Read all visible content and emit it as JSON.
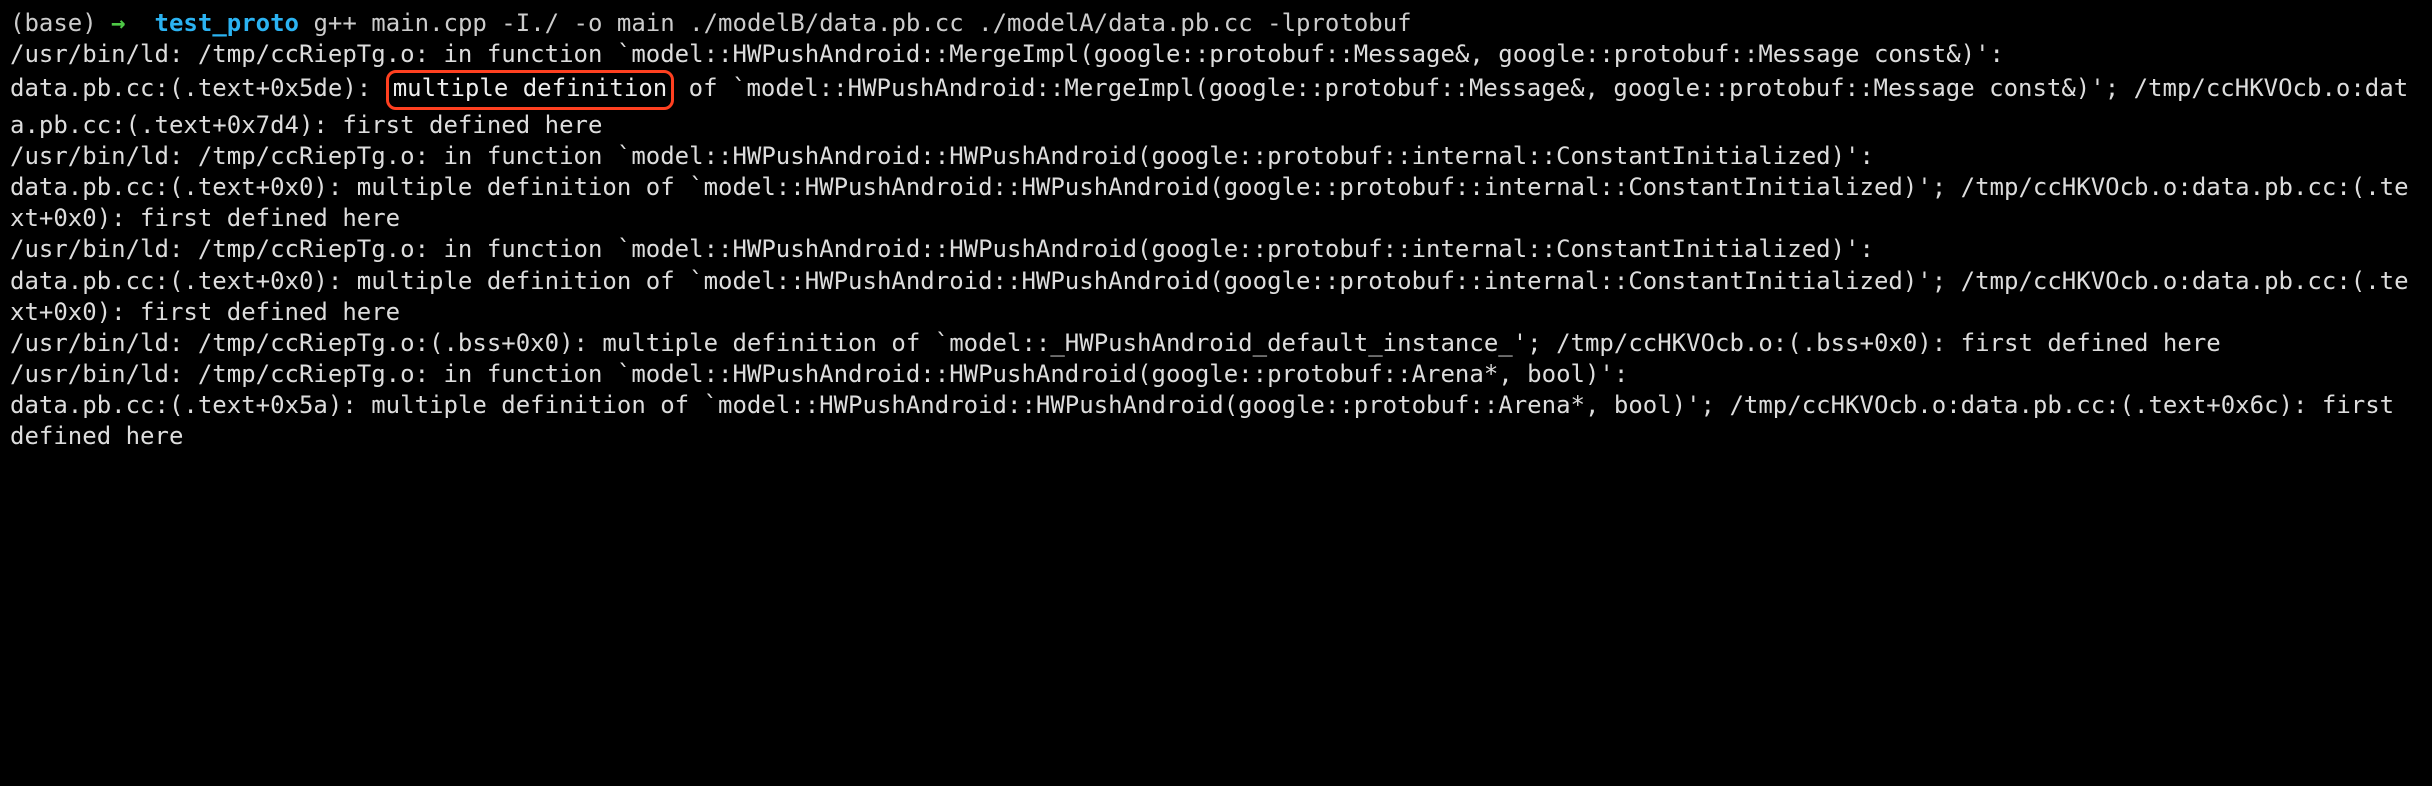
{
  "prompt": {
    "env": "(base)",
    "arrow": "→",
    "cwd": "test_proto",
    "command": "g++ main.cpp -I./ -o main ./modelB/data.pb.cc ./modelA/data.pb.cc -lprotobuf"
  },
  "out": {
    "l1": "/usr/bin/ld: /tmp/ccRiepTg.o: in function `model::HWPushAndroid::MergeImpl(google::protobuf::Message&, google::protobuf::Message const&)':",
    "l2a": "data.pb.cc:(.text+0x5de): ",
    "l2_hl": "multiple definition",
    "l2b": " of `model::HWPushAndroid::MergeImpl(google::protobuf::Message&, google::protobuf::Message const&)'; /tmp/ccHKVOcb.o:data.pb.cc:(.text+0x7d4): first defined here",
    "l3": "/usr/bin/ld: /tmp/ccRiepTg.o: in function `model::HWPushAndroid::HWPushAndroid(google::protobuf::internal::ConstantInitialized)':",
    "l4": "data.pb.cc:(.text+0x0): multiple definition of `model::HWPushAndroid::HWPushAndroid(google::protobuf::internal::ConstantInitialized)'; /tmp/ccHKVOcb.o:data.pb.cc:(.text+0x0): first defined here",
    "l5": "/usr/bin/ld: /tmp/ccRiepTg.o: in function `model::HWPushAndroid::HWPushAndroid(google::protobuf::internal::ConstantInitialized)':",
    "l6": "data.pb.cc:(.text+0x0): multiple definition of `model::HWPushAndroid::HWPushAndroid(google::protobuf::internal::ConstantInitialized)'; /tmp/ccHKVOcb.o:data.pb.cc:(.text+0x0): first defined here",
    "l7": "/usr/bin/ld: /tmp/ccRiepTg.o:(.bss+0x0): multiple definition of `model::_HWPushAndroid_default_instance_'; /tmp/ccHKVOcb.o:(.bss+0x0): first defined here",
    "l8": "/usr/bin/ld: /tmp/ccRiepTg.o: in function `model::HWPushAndroid::HWPushAndroid(google::protobuf::Arena*, bool)':",
    "l9": "data.pb.cc:(.text+0x5a): multiple definition of `model::HWPushAndroid::HWPushAndroid(google::protobuf::Arena*, bool)'; /tmp/ccHKVOcb.o:data.pb.cc:(.text+0x6c): first defined here"
  }
}
